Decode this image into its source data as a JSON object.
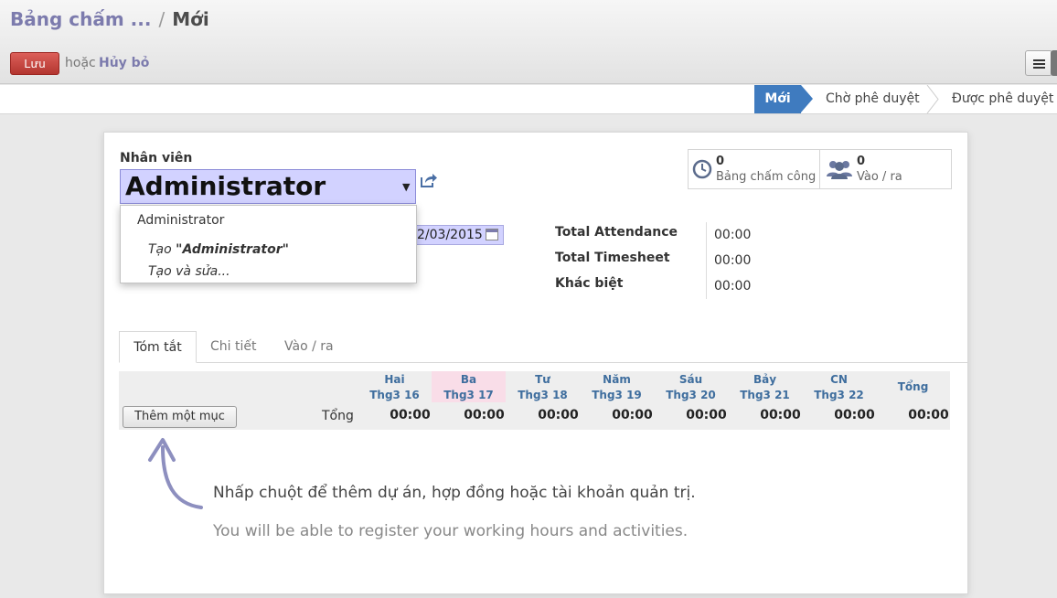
{
  "breadcrumb": {
    "parent": "Bảng chấm ...",
    "separator": "/",
    "current": "Mới"
  },
  "toolbar": {
    "save_label": "Lưu",
    "or_text": "hoặc",
    "discard_label": "Hủy bỏ"
  },
  "status_stages": [
    {
      "label": "Mới",
      "active": true
    },
    {
      "label": "Chờ phê duyệt",
      "active": false
    },
    {
      "label": "Được phê duyệt",
      "active": false
    }
  ],
  "form": {
    "employee_label": "Nhân viên",
    "employee_value": "Administrator",
    "date_value": "2/03/2015",
    "dropdown": {
      "item": "Administrator",
      "create_prefix": "Tạo ",
      "create_value": "\"Administrator\"",
      "create_edit": "Tạo và sửa..."
    }
  },
  "smart_buttons": [
    {
      "count": "0",
      "label": "Bảng chấm công",
      "icon": "clock-icon"
    },
    {
      "count": "0",
      "label": "Vào / ra",
      "icon": "users-icon"
    }
  ],
  "totals": [
    {
      "label": "Total Attendance",
      "value": "00:00"
    },
    {
      "label": "Total Timesheet",
      "value": "00:00"
    },
    {
      "label": "Khác biệt",
      "value": "00:00"
    }
  ],
  "tabs": [
    "Tóm tắt",
    "Chi tiết",
    "Vào / ra"
  ],
  "grid": {
    "days": [
      {
        "day": "Hai",
        "date": "Thg3 16",
        "value": "00:00"
      },
      {
        "day": "Ba",
        "date": "Thg3 17",
        "value": "00:00"
      },
      {
        "day": "Tư",
        "date": "Thg3 18",
        "value": "00:00"
      },
      {
        "day": "Năm",
        "date": "Thg3 19",
        "value": "00:00"
      },
      {
        "day": "Sáu",
        "date": "Thg3 20",
        "value": "00:00"
      },
      {
        "day": "Bảy",
        "date": "Thg3 21",
        "value": "00:00"
      },
      {
        "day": "CN",
        "date": "Thg3 22",
        "value": "00:00"
      }
    ],
    "total_header": "Tổng",
    "total_value": "00:00",
    "row_label": "Tổng",
    "add_button": "Thêm một mục"
  },
  "hints": {
    "line1": "Nhấp chuột để thêm dự án, hợp đồng hoặc tài khoản quản trị.",
    "line2": "You will be able to register your working hours and activities."
  },
  "colors": {
    "accent": "#7c7bad",
    "active_stage": "#3f7bbf",
    "save": "#c4403a",
    "today": "#f9dde8"
  }
}
